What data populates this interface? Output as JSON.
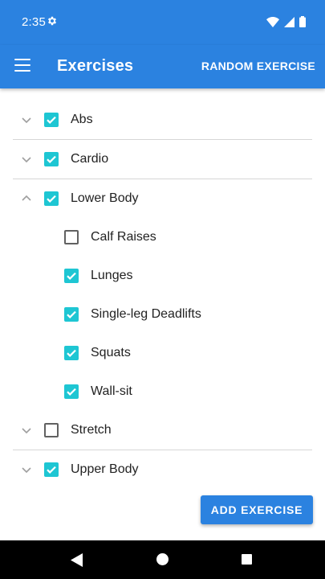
{
  "status_bar": {
    "time": "2:35",
    "icons": [
      "gear-icon",
      "wifi-icon",
      "cellular-icon",
      "battery-icon"
    ]
  },
  "app_bar": {
    "title": "Exercises",
    "action_label": "RANDOM EXERCISE",
    "color": "#2b82e0"
  },
  "groups": [
    {
      "label": "Abs",
      "checked": true,
      "expanded": false
    },
    {
      "label": "Cardio",
      "checked": true,
      "expanded": false
    },
    {
      "label": "Lower Body",
      "checked": true,
      "expanded": true,
      "children": [
        {
          "label": "Calf Raises",
          "checked": false
        },
        {
          "label": "Lunges",
          "checked": true
        },
        {
          "label": "Single-leg Deadlifts",
          "checked": true
        },
        {
          "label": "Squats",
          "checked": true
        },
        {
          "label": "Wall-sit",
          "checked": true
        }
      ]
    },
    {
      "label": "Stretch",
      "checked": false,
      "expanded": false
    },
    {
      "label": "Upper Body",
      "checked": true,
      "expanded": false
    }
  ],
  "add_button": {
    "label": "ADD EXERCISE"
  },
  "checkbox_color": "#1ec6d3"
}
